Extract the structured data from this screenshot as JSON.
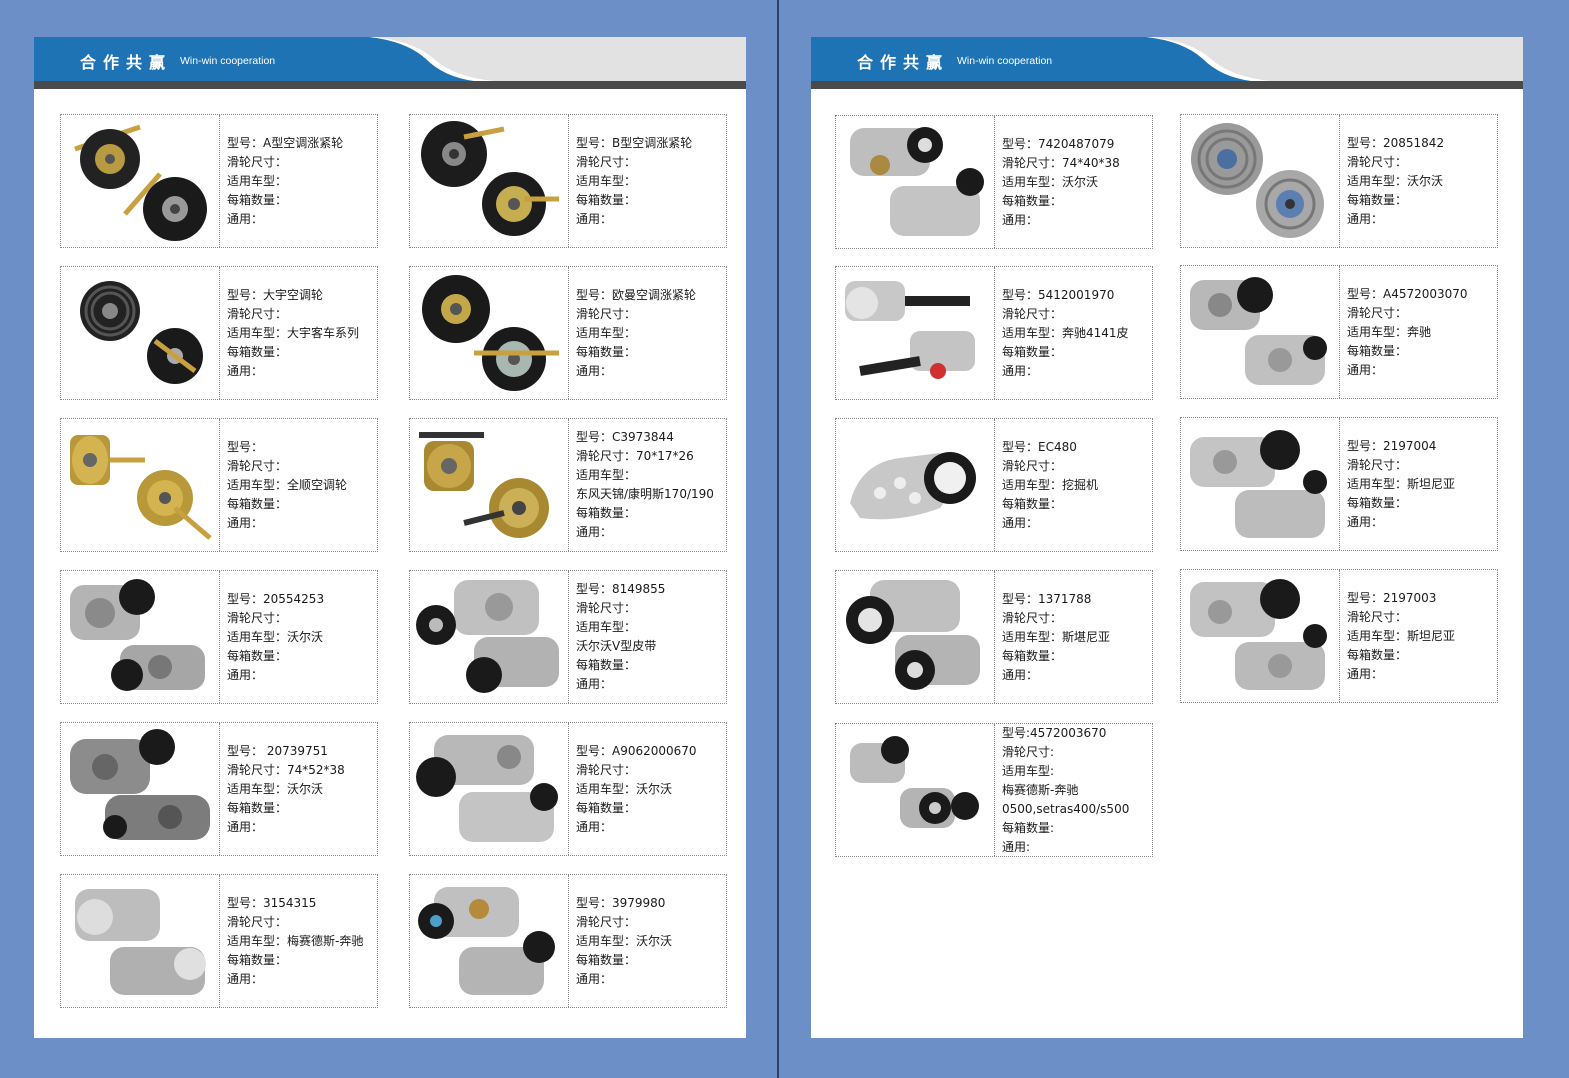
{
  "header": {
    "title_cn": "合作共赢",
    "title_en": "Win-win cooperation"
  },
  "colors": {
    "background": "#6c8fc8",
    "header_blue": "#1e73b4",
    "header_bar": "#4a4a4a"
  },
  "left_page": {
    "cards": [
      {
        "model": "型号：A型空调涨紧轮",
        "size": "滑轮尺寸：",
        "vehicle": "适用车型：",
        "qty": "每箱数量：",
        "general": "通用："
      },
      {
        "model": "型号：B型空调涨紧轮",
        "size": "滑轮尺寸：",
        "vehicle": "适用车型：",
        "qty": "每箱数量：",
        "general": "通用："
      },
      {
        "model": "型号：大宇空调轮",
        "size": "滑轮尺寸：",
        "vehicle": "适用车型：大宇客车系列",
        "qty": "每箱数量：",
        "general": "通用："
      },
      {
        "model": "型号：欧曼空调涨紧轮",
        "size": "滑轮尺寸：",
        "vehicle": "适用车型：",
        "qty": "每箱数量：",
        "general": "通用："
      },
      {
        "model": "型号：",
        "size": "滑轮尺寸：",
        "vehicle": "适用车型：全顺空调轮",
        "qty": "每箱数量：",
        "general": "通用："
      },
      {
        "model": "型号：C3973844",
        "size": "滑轮尺寸：70*17*26",
        "vehicle": "适用车型：",
        "vehicle2": "东风天锦/康明斯170/190",
        "qty": "每箱数量：",
        "general": "通用："
      },
      {
        "model": "型号：20554253",
        "size": "滑轮尺寸：",
        "vehicle": "适用车型：沃尔沃",
        "qty": "每箱数量：",
        "general": "通用："
      },
      {
        "model": "型号：8149855",
        "size": "滑轮尺寸：",
        "vehicle": "适用车型：",
        "vehicle2": "沃尔沃V型皮带",
        "qty": "每箱数量：",
        "general": "通用："
      },
      {
        "model": "型号： 20739751",
        "size": "滑轮尺寸：74*52*38",
        "vehicle": "适用车型：沃尔沃",
        "qty": "每箱数量：",
        "general": "通用："
      },
      {
        "model": "型号：A9062000670",
        "size": "滑轮尺寸：",
        "vehicle": "适用车型：沃尔沃",
        "qty": "每箱数量：",
        "general": "通用："
      },
      {
        "model": "型号：3154315",
        "size": "滑轮尺寸：",
        "vehicle": "适用车型：梅赛德斯-奔驰",
        "qty": "每箱数量：",
        "general": "通用："
      },
      {
        "model": "型号：3979980",
        "size": "滑轮尺寸：",
        "vehicle": "适用车型：沃尔沃",
        "qty": "每箱数量：",
        "general": "通用："
      }
    ]
  },
  "right_page": {
    "cards": [
      {
        "model": "型号：7420487079",
        "size": "滑轮尺寸：74*40*38",
        "vehicle": "适用车型：沃尔沃",
        "qty": "每箱数量：",
        "general": "通用："
      },
      {
        "model": "型号：20851842",
        "size": "滑轮尺寸：",
        "vehicle": "适用车型：沃尔沃",
        "qty": "每箱数量：",
        "general": "通用："
      },
      {
        "model": "型号：5412001970",
        "size": "滑轮尺寸：",
        "vehicle": "适用车型：奔驰4141皮",
        "qty": "每箱数量：",
        "general": "通用："
      },
      {
        "model": "型号：A4572003070",
        "size": "滑轮尺寸：",
        "vehicle": "适用车型：奔驰",
        "qty": "每箱数量：",
        "general": "通用："
      },
      {
        "model": "型号：EC480",
        "size": "滑轮尺寸：",
        "vehicle": "适用车型：挖掘机",
        "qty": "每箱数量：",
        "general": "通用："
      },
      {
        "model": "型号：2197004",
        "size": "滑轮尺寸：",
        "vehicle": "适用车型：斯坦尼亚",
        "qty": "每箱数量：",
        "general": "通用："
      },
      {
        "model": "型号：1371788",
        "size": "滑轮尺寸：",
        "vehicle": "适用车型：斯堪尼亚",
        "qty": "每箱数量：",
        "general": "通用："
      },
      {
        "model": "型号：2197003",
        "size": "滑轮尺寸：",
        "vehicle": "适用车型：斯坦尼亚",
        "qty": "每箱数量：",
        "general": "通用："
      },
      {
        "model": "型号:4572003670",
        "size": "滑轮尺寸:",
        "vehicle": "适用车型:",
        "vehicle2": "梅赛德斯-奔驰",
        "vehicle3": "0500,setras400/s500",
        "qty": "每箱数量:",
        "general": "通用:"
      }
    ]
  }
}
